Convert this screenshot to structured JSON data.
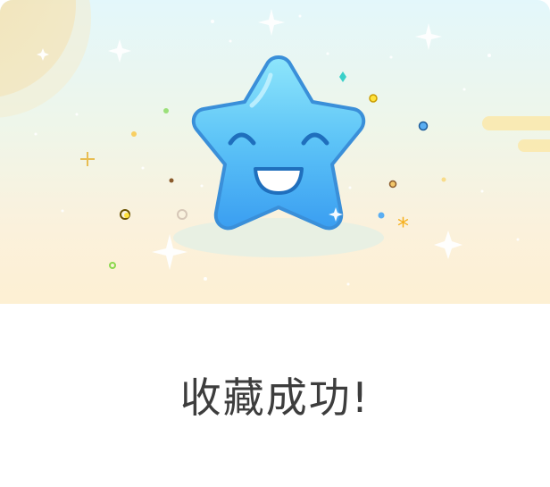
{
  "dialog": {
    "illustration": "smiling-star-illustration",
    "message": "收藏成功!"
  }
}
